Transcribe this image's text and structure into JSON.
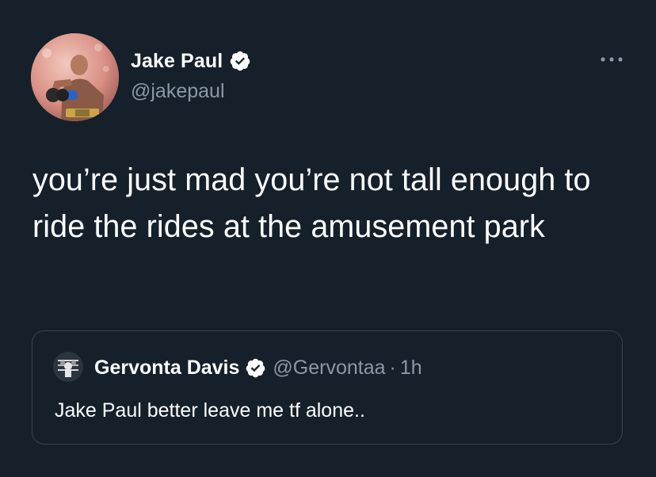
{
  "tweet": {
    "author_name": "Jake Paul",
    "author_handle": "@jakepaul",
    "text": "you’re just mad you’re not tall enough to ride the rides at the amusement park",
    "verified": true,
    "icons": {
      "avatar": "avatar-photo",
      "verified": "verified-badge-icon",
      "more": "more-options-icon"
    }
  },
  "quote": {
    "author_name": "Gervonta Davis",
    "author_handle": "@Gervontaa",
    "separator": "·",
    "time": "1h",
    "text": "Jake Paul better leave me tf alone..",
    "verified": true
  },
  "colors": {
    "background": "#15202b",
    "text_primary": "#ffffff",
    "text_secondary": "#8b98a5",
    "border": "#38444d",
    "verified_badge": "#ffffff"
  }
}
